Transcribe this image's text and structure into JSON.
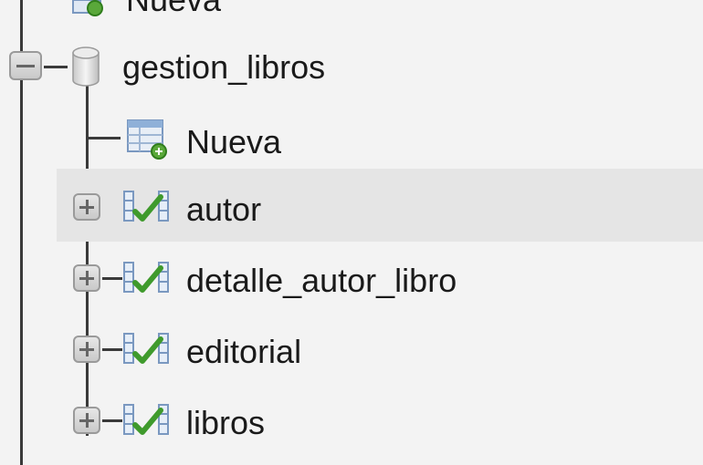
{
  "tree": {
    "top_partial_label": "Nueva",
    "database": {
      "name": "gestion_libros",
      "icon": "database-icon"
    },
    "children": [
      {
        "label": "Nueva",
        "icon": "new-table-icon",
        "toggle": "none"
      },
      {
        "label": "autor",
        "icon": "table-icon",
        "toggle": "expand",
        "highlighted": true
      },
      {
        "label": "detalle_autor_libro",
        "icon": "table-icon",
        "toggle": "expand"
      },
      {
        "label": "editorial",
        "icon": "table-icon",
        "toggle": "expand"
      },
      {
        "label": "libros",
        "icon": "table-icon",
        "toggle": "expand"
      }
    ]
  }
}
